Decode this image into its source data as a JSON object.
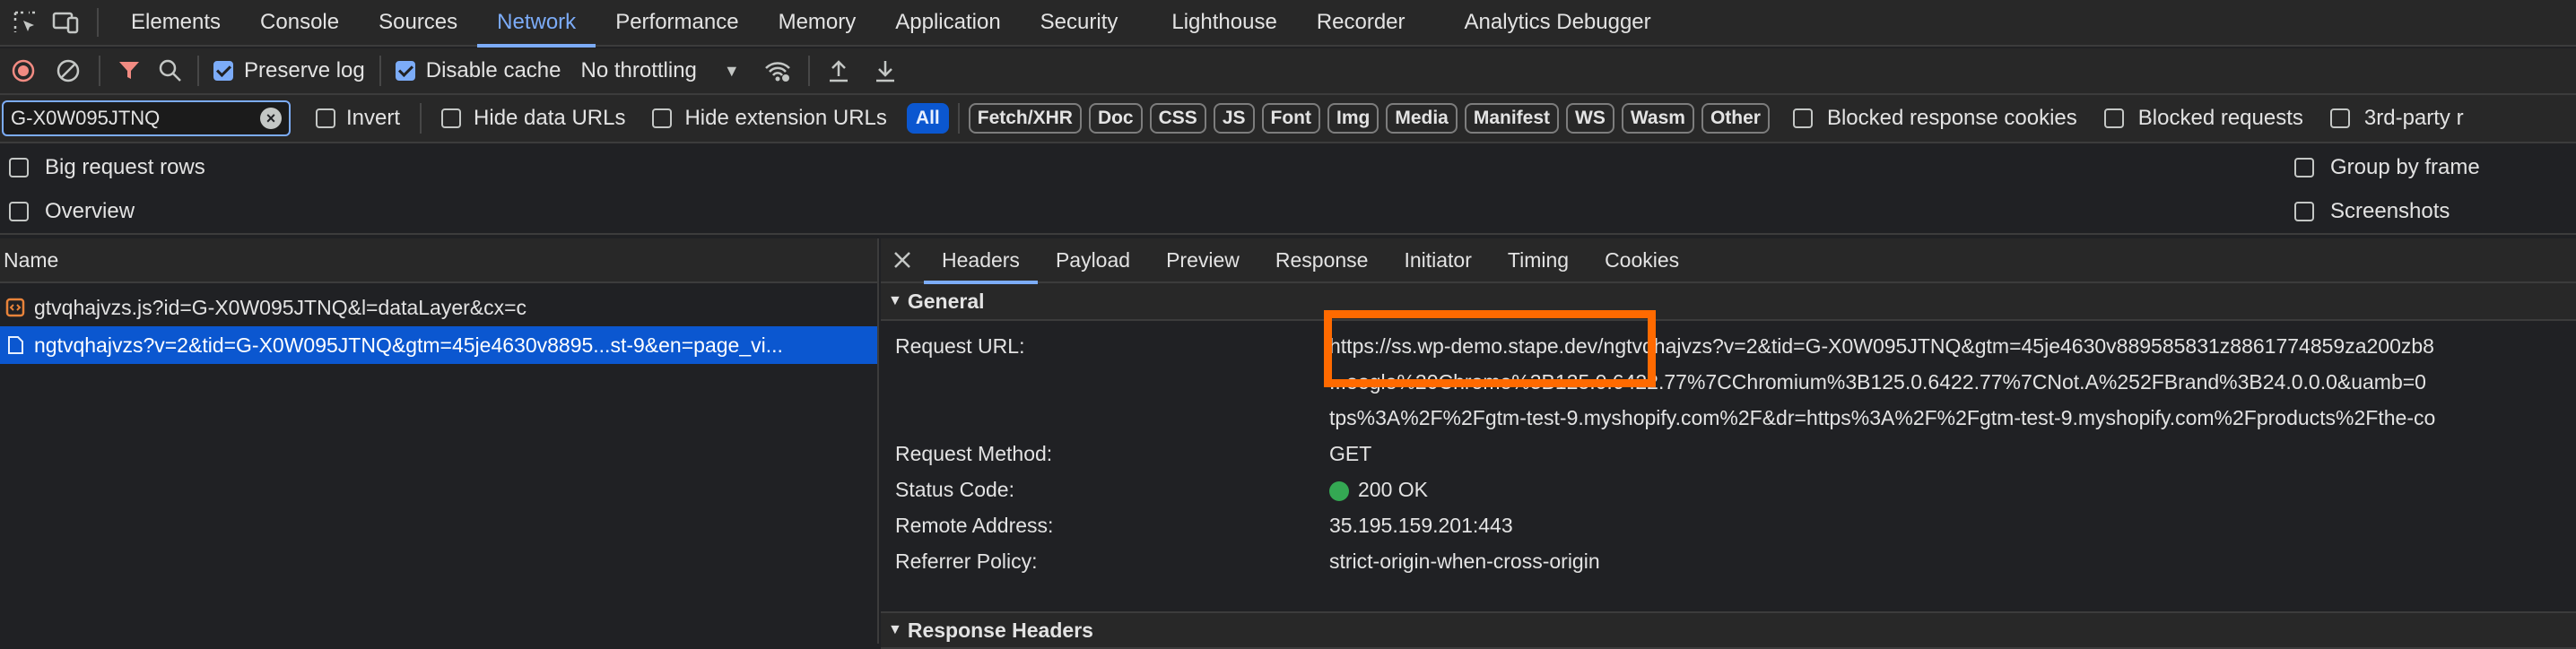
{
  "tabs": [
    "Elements",
    "Console",
    "Sources",
    "Network",
    "Performance",
    "Memory",
    "Application",
    "Security",
    "Lighthouse",
    "Recorder",
    "Analytics Debugger"
  ],
  "toolbar": {
    "preserve_log": "Preserve log",
    "disable_cache": "Disable cache",
    "throttling": "No throttling"
  },
  "filter": {
    "value": "G-X0W095JTNQ",
    "invert": "Invert",
    "hide_data_urls": "Hide data URLs",
    "hide_extension_urls": "Hide extension URLs",
    "types": [
      "All",
      "Fetch/XHR",
      "Doc",
      "CSS",
      "JS",
      "Font",
      "Img",
      "Media",
      "Manifest",
      "WS",
      "Wasm",
      "Other"
    ],
    "blocked_response_cookies": "Blocked response cookies",
    "blocked_requests": "Blocked requests",
    "third_party": "3rd-party r"
  },
  "options": {
    "big_request_rows": "Big request rows",
    "overview": "Overview",
    "group_by_frame": "Group by frame",
    "screenshots": "Screenshots"
  },
  "list": {
    "header": "Name",
    "rows": [
      "gtvqhajvzs.js?id=G-X0W095JTNQ&l=dataLayer&cx=c",
      "ngtvqhajvzs?v=2&tid=G-X0W095JTNQ&gtm=45je4630v8895...st-9&en=page_vi..."
    ]
  },
  "detail": {
    "tabs": [
      "Headers",
      "Payload",
      "Preview",
      "Response",
      "Initiator",
      "Timing",
      "Cookies"
    ],
    "general_label": "General",
    "response_headers_label": "Response Headers",
    "request_url_key": "Request URL:",
    "request_url_host": "https://ss.wp-demo.stape.dev/",
    "request_url_rest": "ngtvqhajvzs?v=2&tid=G-X0W095JTNQ&gtm=45je4630v889585831z8861774859za200zb8",
    "request_url_line2": "...oogle%20Chrome%3B125.0.6422.77%7CChromium%3B125.0.6422.77%7CNot.A%252FBrand%3B24.0.0.0&uamb=0",
    "request_url_line3": "tps%3A%2F%2Fgtm-test-9.myshopify.com%2F&dr=https%3A%2F%2Fgtm-test-9.myshopify.com%2Fproducts%2Fthe-co",
    "method_key": "Request Method:",
    "method_val": "GET",
    "status_key": "Status Code:",
    "status_val": "200 OK",
    "remote_key": "Remote Address:",
    "remote_val": "35.195.159.201:443",
    "referrer_key": "Referrer Policy:",
    "referrer_val": "strict-origin-when-cross-origin"
  },
  "colors": {
    "accent": "#7cacf8",
    "selected_row": "#0b57d0",
    "highlight_box": "#ff6a00",
    "status_ok": "#34a853",
    "record_red": "#f28b82",
    "filter_red": "#f28b82"
  }
}
